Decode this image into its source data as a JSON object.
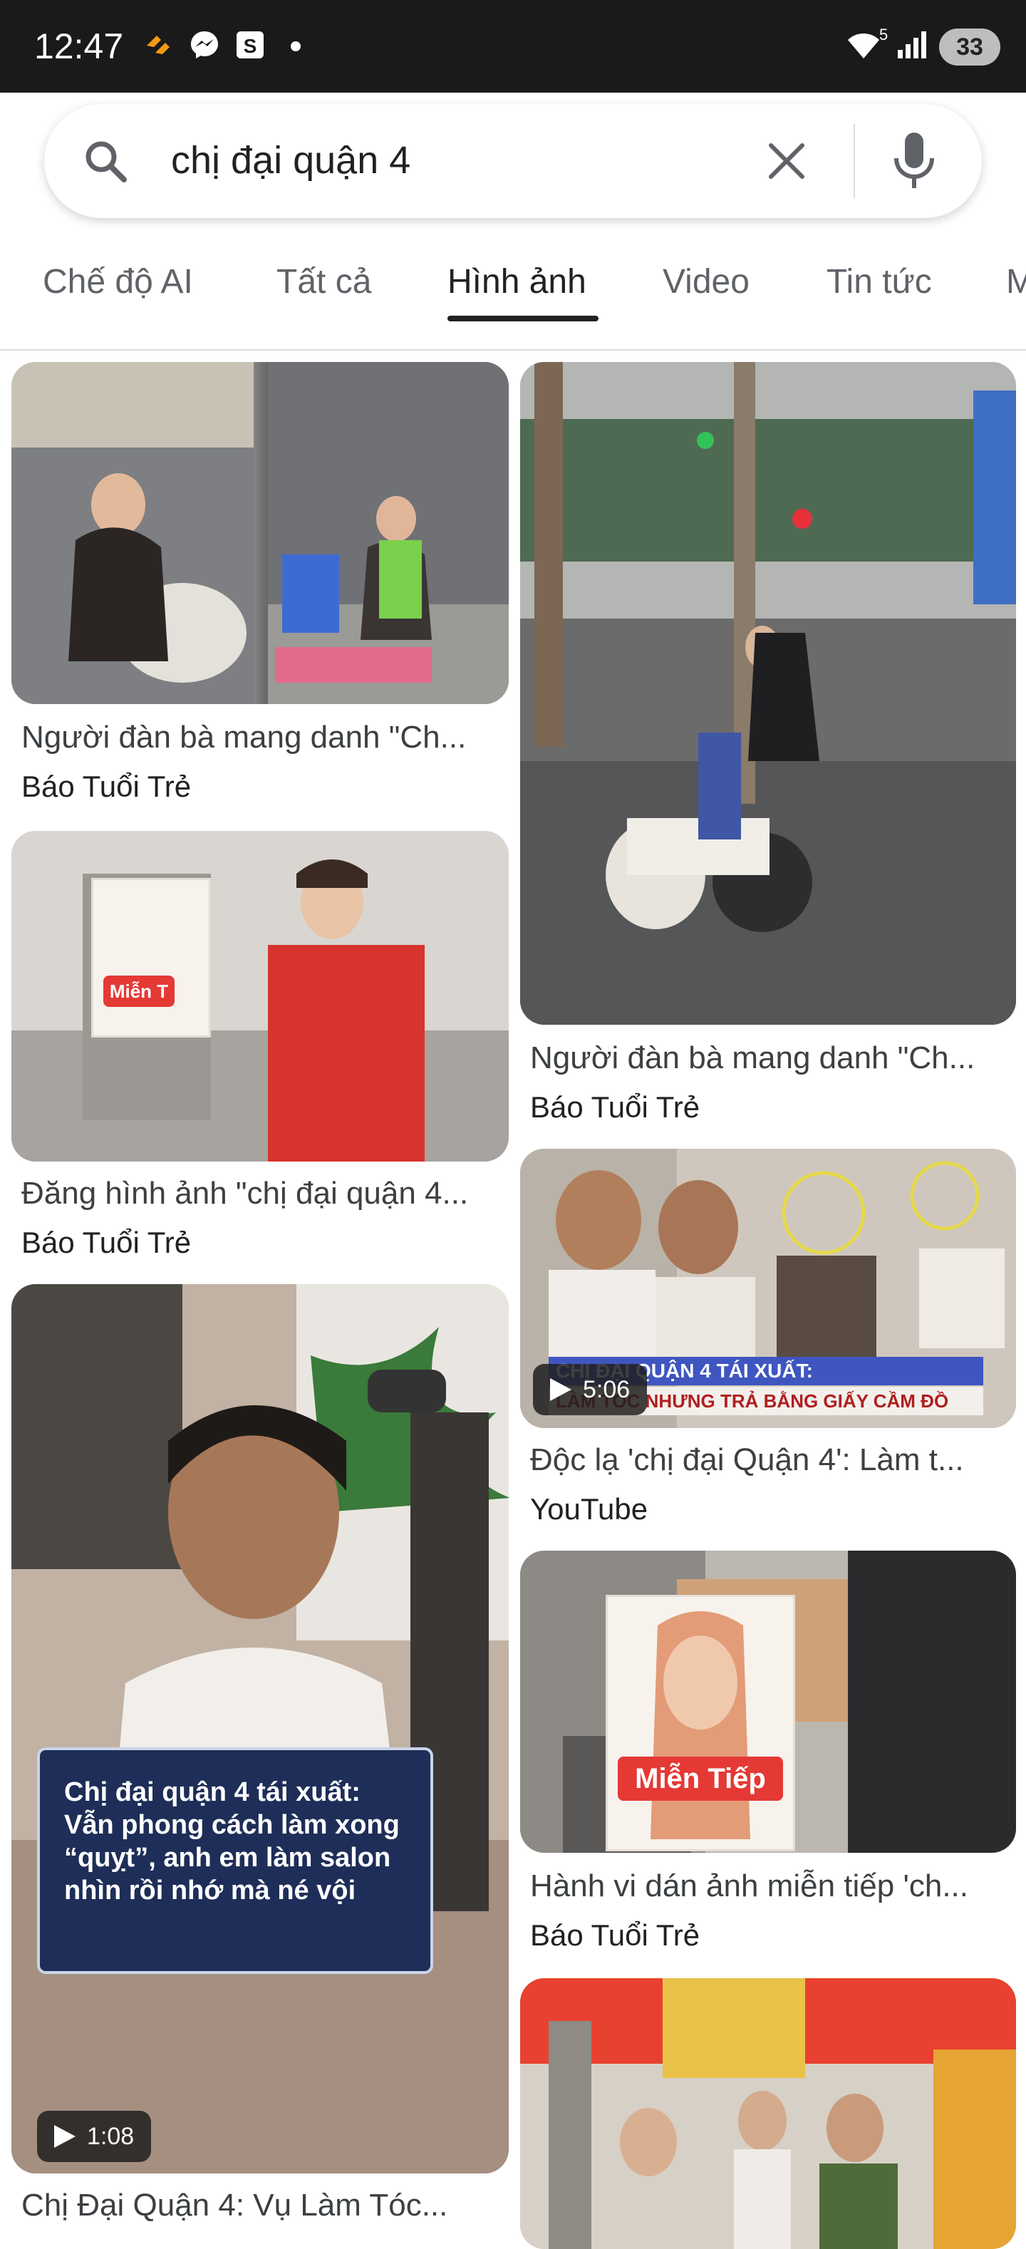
{
  "status_bar": {
    "time": "12:47",
    "icons": [
      "shopee-icon",
      "messenger-icon",
      "s-app-icon",
      "dot-icon",
      "wifi-icon",
      "signal-icon"
    ],
    "wifi_level": "5",
    "battery": "33"
  },
  "search": {
    "query": "chị đại quận 4"
  },
  "tabs": [
    {
      "label": "Chế độ AI",
      "active": false
    },
    {
      "label": "Tất cả",
      "active": false
    },
    {
      "label": "Hình ảnh",
      "active": true
    },
    {
      "label": "Video",
      "active": false
    },
    {
      "label": "Tin tức",
      "active": false
    },
    {
      "label": "M",
      "active": false
    }
  ],
  "results": [
    {
      "title": "Người đàn bà mang danh \"Ch...",
      "source": "Báo Tuổi Trẻ"
    },
    {
      "title": "Người đàn bà mang danh \"Ch...",
      "source": "Báo Tuổi Trẻ"
    },
    {
      "title": "Đăng hình ảnh \"chị đại quận 4...",
      "source": "Báo Tuổi Trẻ"
    },
    {
      "title": "Độc lạ 'chị đại Quận 4': Làm t...",
      "source": "YouTube",
      "duration": "5:06",
      "overlay_line1": "CHỊ ĐẠI QUẬN 4 TÁI XUẤT:",
      "overlay_line2": "LÀM TÓC NHƯNG TRẢ BẰNG GIẤY CẦM ĐỒ"
    },
    {
      "title": "Chị Đại Quận 4: Vụ Làm Tóc...",
      "source": "",
      "duration": "1:08",
      "overlay": "Chị đại quận 4 tái xuất:\nVẫn phong cách làm xong\n“quỵt”, anh em làm salon\nnhìn rồi nhớ mà né vội"
    },
    {
      "title": "Hành vi dán ảnh miễn tiếp 'ch...",
      "source": "Báo Tuổi Trẻ",
      "sign_text": "Miễn Tiếp"
    },
    {
      "title": "",
      "source": ""
    }
  ],
  "sign_small": "Miễn T",
  "colors": {
    "status_bar": "#1a1a1a",
    "active_tab": "#202124",
    "inactive_tab": "#5f6368",
    "red_label": "#e53935"
  }
}
